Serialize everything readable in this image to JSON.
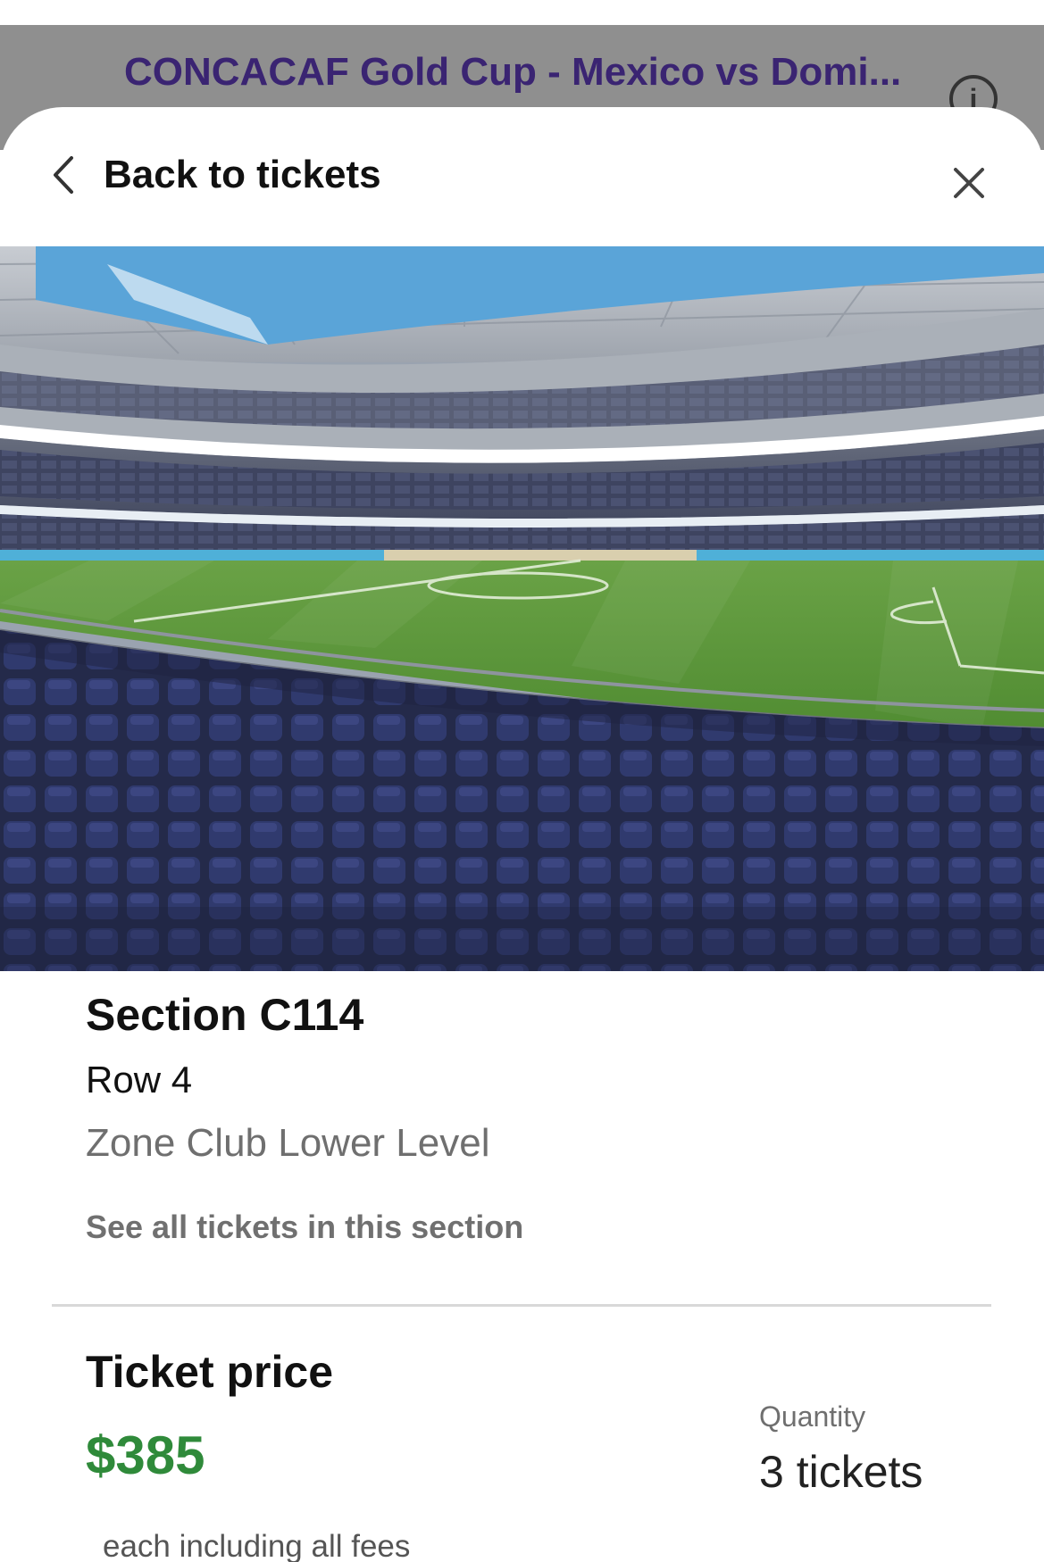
{
  "underlying_page": {
    "title": "CONCACAF Gold Cup - Mexico vs Domi...",
    "info_icon": "info-circle-icon",
    "info_glyph": "i"
  },
  "modal": {
    "back_label": "Back to tickets",
    "back_icon": "chevron-left-icon",
    "close_icon": "close-icon"
  },
  "listing": {
    "section": "Section C114",
    "row": "Row 4",
    "zone": "Zone Club Lower Level",
    "see_all_link": "See all tickets in this section"
  },
  "price": {
    "heading": "Ticket price",
    "value": "$385",
    "note": "each including all fees",
    "quantity_label": "Quantity",
    "quantity_value": "3 tickets"
  },
  "colors": {
    "title_purple": "#3a2472",
    "price_green": "#2f8a3a",
    "seat_blue": "#2f3766",
    "pitch_green": "#5c9a3a"
  }
}
